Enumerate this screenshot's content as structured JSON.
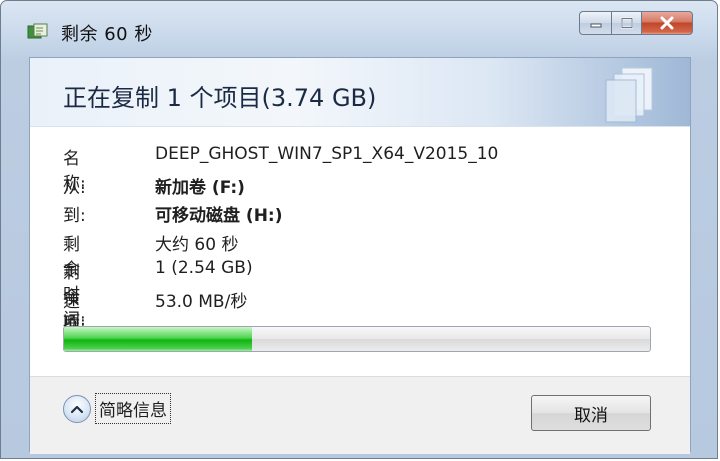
{
  "window": {
    "title": "剩余 60 秒",
    "icon": "copy-files-icon"
  },
  "header": {
    "title": "正在复制 1 个项目(3.74 GB)"
  },
  "details": [
    {
      "label": "名称:",
      "value": "DEEP_GHOST_WIN7_SP1_X64_V2015_10",
      "bold": false
    },
    {
      "label": "从:",
      "value": "新加卷 (F:)",
      "bold": true
    },
    {
      "label": "到:",
      "value": "可移动磁盘 (H:)",
      "bold": true
    },
    {
      "label": "剩余时间:",
      "value": "大约 60 秒",
      "bold": false
    },
    {
      "label": "剩余项:",
      "value": "1 (2.54 GB)",
      "bold": false
    },
    {
      "label": "速度:",
      "value": "53.0 MB/秒",
      "bold": false
    }
  ],
  "progress": {
    "fraction": 0.32,
    "color": "#22c022"
  },
  "footer": {
    "toggle_label": "简略信息",
    "toggle_icon": "chevron-up-icon",
    "cancel_label": "取消"
  },
  "colors": {
    "frame": "#bccde2",
    "close_button": "#c04628",
    "header_text": "#1b2a44"
  }
}
